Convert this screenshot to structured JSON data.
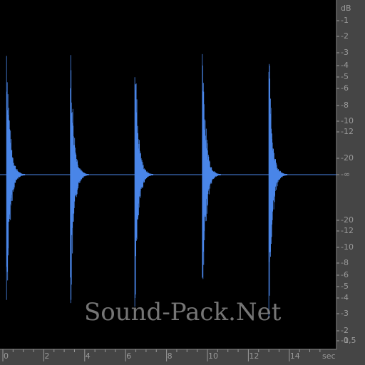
{
  "db_scale": {
    "unit": "dB",
    "labels": [
      "-1",
      "-2",
      "-3",
      "-4",
      "-5",
      "-6",
      "-8",
      "-10",
      "-12",
      "-20",
      "-∞",
      "-20",
      "-12",
      "-10",
      "-8",
      "-6",
      "-5",
      "-4",
      "-3",
      "-2",
      "-1",
      "-0,5"
    ]
  },
  "time_scale": {
    "unit": "sec",
    "labels": [
      "0",
      "2",
      "4",
      "6",
      "8",
      "10",
      "12",
      "14"
    ]
  },
  "watermark": "Sound-Pack.Net",
  "colors": {
    "waveform": "#4a86e8",
    "background": "#000000",
    "ruler": "#454545",
    "label": "#9a9a9a"
  },
  "waveform": {
    "hit_times_sec": [
      0.18,
      3.3,
      6.45,
      9.75,
      13.0
    ],
    "peak_top_db": [
      -1,
      -1,
      -1,
      -0.5,
      -2
    ],
    "peak_bottom_db": [
      -2,
      -1,
      -2,
      -1,
      -1
    ]
  }
}
